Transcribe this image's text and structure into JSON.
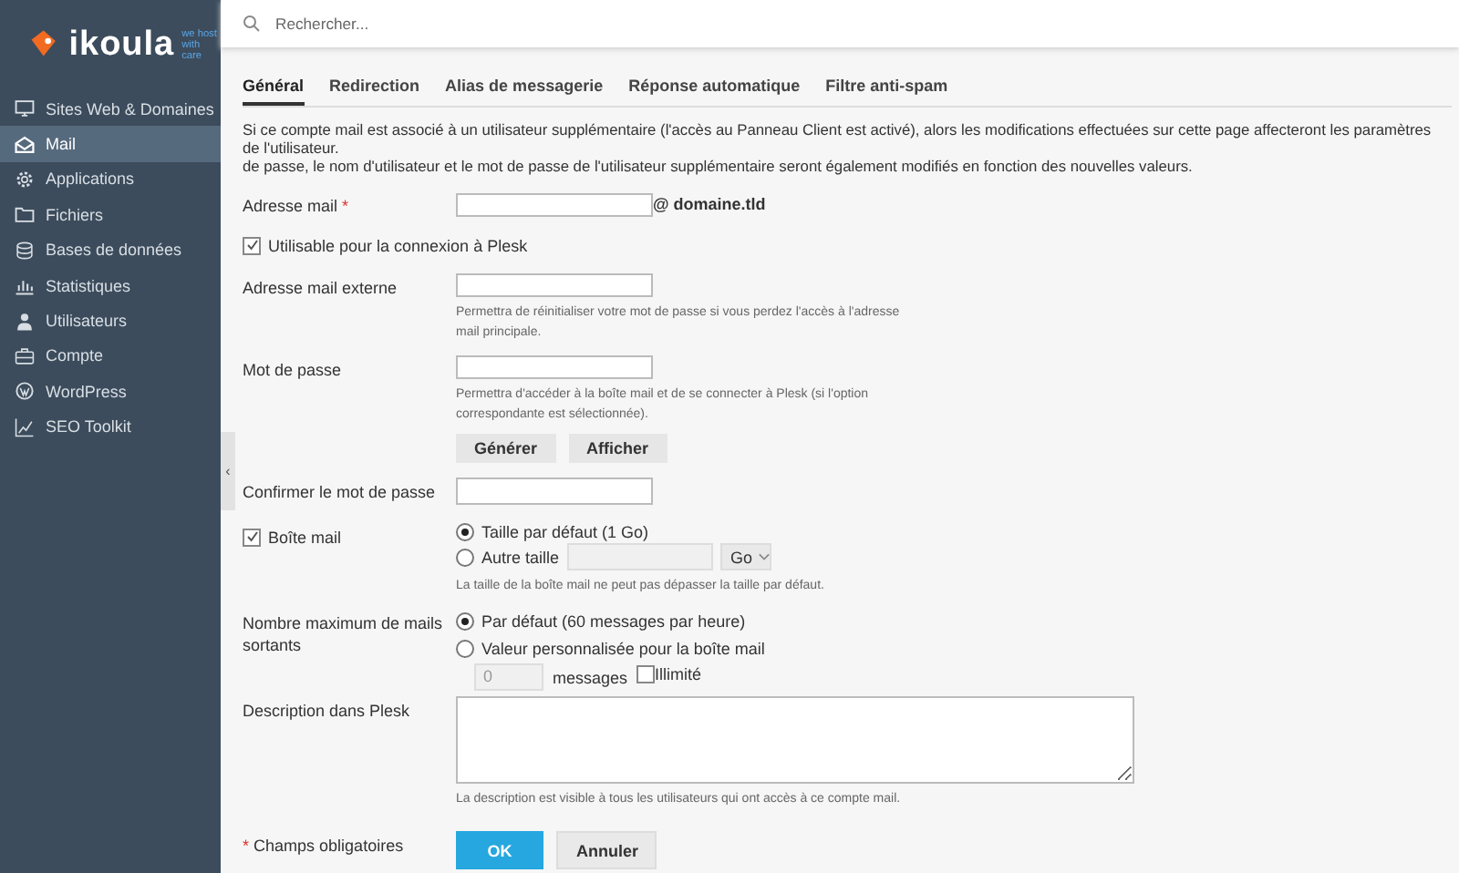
{
  "logo": {
    "name": "ikoula",
    "tagline": "we host with care"
  },
  "sidebar": {
    "items": [
      {
        "label": "Sites Web & Domaines",
        "selected": false
      },
      {
        "label": "Mail",
        "selected": true
      },
      {
        "label": "Applications",
        "selected": false
      },
      {
        "label": "Fichiers",
        "selected": false
      },
      {
        "label": "Bases de données",
        "selected": false
      },
      {
        "label": "Statistiques",
        "selected": false
      },
      {
        "label": "Utilisateurs",
        "selected": false
      },
      {
        "label": "Compte",
        "selected": false
      },
      {
        "label": "WordPress",
        "selected": false
      },
      {
        "label": "SEO Toolkit",
        "selected": false
      }
    ],
    "collapse": "‹"
  },
  "search": {
    "placeholder": "Rechercher..."
  },
  "tabs": [
    {
      "label": "Général",
      "selected": true
    },
    {
      "label": "Redirection",
      "selected": false
    },
    {
      "label": "Alias de messagerie",
      "selected": false
    },
    {
      "label": "Réponse automatique",
      "selected": false
    },
    {
      "label": "Filtre anti-spam",
      "selected": false
    }
  ],
  "intro": [
    "Si ce compte mail est associé à un utilisateur supplémentaire (l'accès au Panneau Client est activé), alors les modifications effectuées sur cette page affecteront les paramètres de l'utilisateur.",
    "de passe, le nom d'utilisateur et le mot de passe de l'utilisateur supplémentaire seront également modifiés en fonction des nouvelles valeurs."
  ],
  "form": {
    "email": {
      "label": "Adresse mail",
      "required_mark": "*",
      "domain": "@ domaine.tld"
    },
    "plesk_login": {
      "label": "Utilisable pour la connexion à Plesk",
      "checked": true
    },
    "external_email": {
      "label": "Adresse mail externe",
      "hint": "Permettra de réinitialiser votre mot de passe si vous perdez l'accès à l'adresse mail principale."
    },
    "password": {
      "label": "Mot de passe",
      "hint": "Permettra d'accéder à la boîte mail et de se connecter à Plesk (si l'option correspondante est sélectionnée).",
      "buttons": [
        "Générer",
        "Afficher"
      ]
    },
    "confirm_password": {
      "label": "Confirmer le mot de passe"
    },
    "mailbox": {
      "label": "Boîte mail",
      "checked": true,
      "options": [
        {
          "label": "Taille par défaut (1 Go)",
          "selected": true
        },
        {
          "label": "Autre taille",
          "selected": false,
          "unit": "Go"
        }
      ],
      "hint": "La taille de la boîte mail ne peut pas dépasser la taille par défaut."
    },
    "outgoing": {
      "label": "Nombre maximum de mails sortants",
      "options": [
        {
          "label": "Par défaut (60 messages par heure)",
          "selected": true
        },
        {
          "label": "Valeur personnalisée pour la boîte mail",
          "selected": false
        }
      ],
      "count": "0",
      "count_unit": "messages",
      "unlimited": {
        "label": "Illimité",
        "checked": false
      }
    },
    "description": {
      "label": "Description dans Plesk",
      "hint": "La description est visible à tous les utilisateurs qui ont accès à ce compte mail."
    },
    "required_note": {
      "mark": "*",
      "text": "Champs obligatoires"
    },
    "buttons": [
      {
        "label": "OK",
        "kind": "primary"
      },
      {
        "label": "Annuler",
        "kind": "secondary"
      }
    ]
  }
}
